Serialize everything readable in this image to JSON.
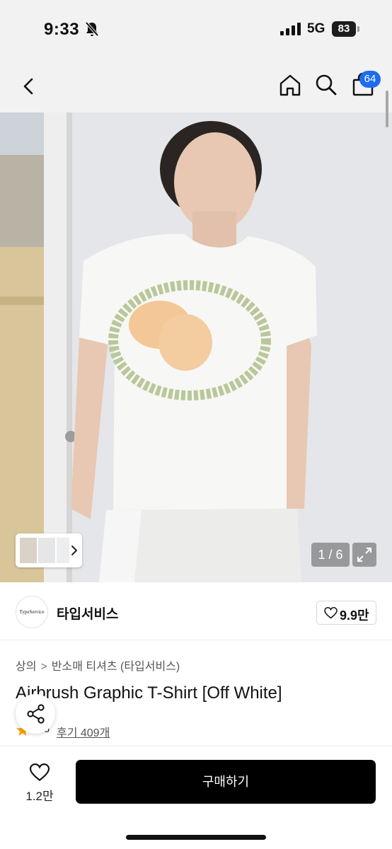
{
  "status_bar": {
    "time": "9:33",
    "network": "5G",
    "battery": "83",
    "icons": [
      "bell-off-icon",
      "signal-icon",
      "battery-icon"
    ]
  },
  "nav": {
    "icons": [
      "back-icon",
      "home-icon",
      "search-icon",
      "cart-icon"
    ],
    "cart_count": "64"
  },
  "gallery": {
    "counter": "1 / 6",
    "thumbnail_icon": "chevron-right-icon",
    "expand_icon": "expand-icon"
  },
  "brand": {
    "logo_text": "TypeService",
    "name": "타입서비스",
    "likes": "9.9만"
  },
  "product": {
    "breadcrumb": [
      "상의",
      "반소매 티셔츠 (타입서비스)"
    ],
    "breadcrumb_separator": ">",
    "title": "Airbrush Graphic T-Shirt [Off White]",
    "rating": "4.8",
    "reviews": "후기 409개"
  },
  "bottom_bar": {
    "wish_count": "1.2만",
    "buy_label": "구매하기"
  },
  "colors": {
    "accent": "#1e6cf0",
    "star": "#f5a300",
    "buy_button": "#000000"
  }
}
